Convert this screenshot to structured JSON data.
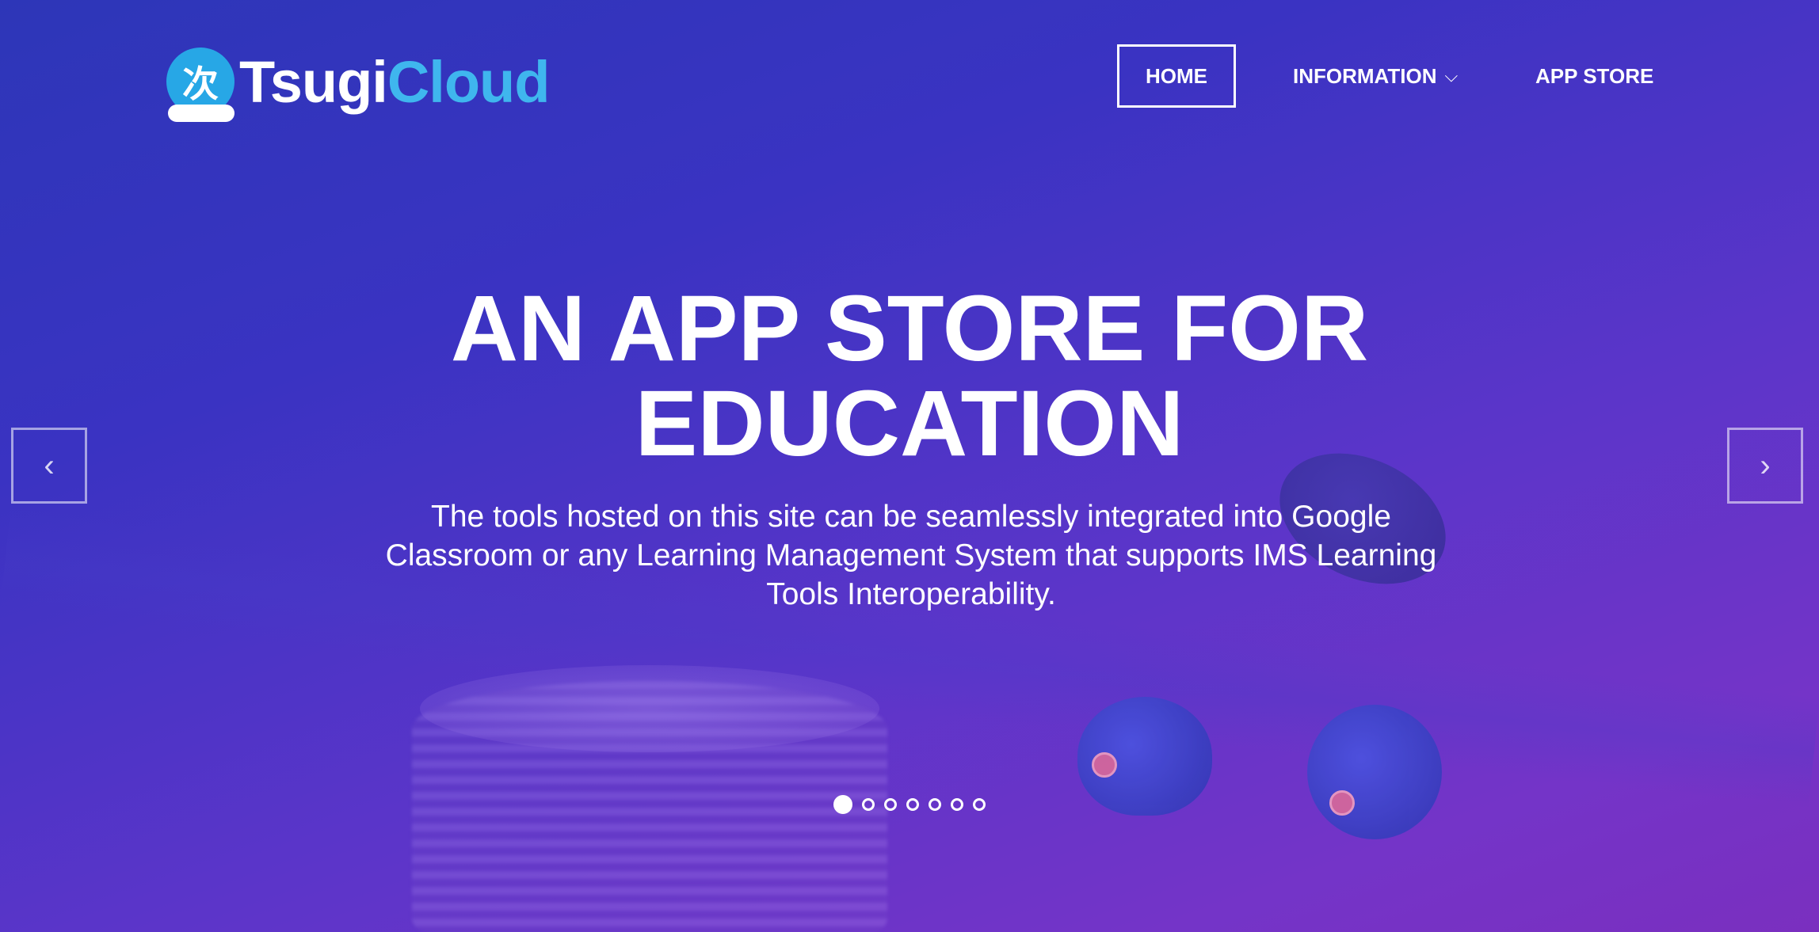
{
  "brand": {
    "logo_glyph": "次",
    "name_part1": "Tsugi",
    "name_part2": "Cloud",
    "accent_color": "#3fb6ee"
  },
  "nav": {
    "home": "HOME",
    "information": "INFORMATION",
    "app_store": "APP STORE"
  },
  "hero": {
    "headline_line1": "AN APP STORE FOR",
    "headline_line2": "EDUCATION",
    "description": "The tools hosted on this site can be seamlessly integrated into Google Classroom or any Learning Management System that supports IMS Learning Tools Interoperability."
  },
  "carousel": {
    "prev_icon": "chevron-left-icon",
    "next_icon": "chevron-right-icon",
    "slide_count": 7,
    "active_index": 0
  }
}
